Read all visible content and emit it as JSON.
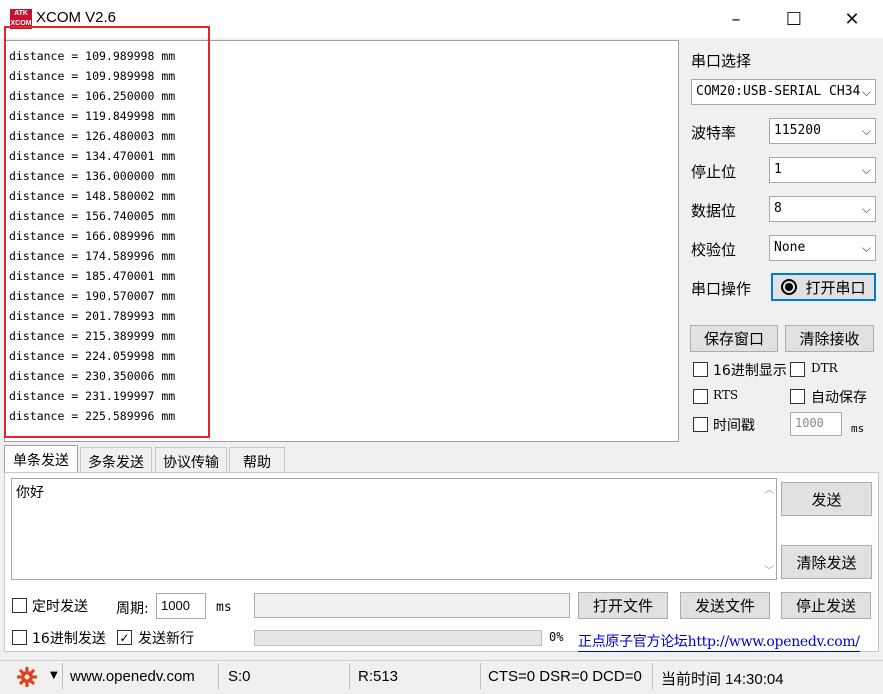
{
  "window": {
    "title": "XCOM V2.6",
    "logo_text": "ATK XCOM"
  },
  "titlebar": {
    "minimize": "–",
    "maximize": "☐",
    "close": "✕"
  },
  "receive": {
    "lines": [
      "distance = 109.989998 mm",
      "distance = 109.989998 mm",
      "distance = 106.250000 mm",
      "distance = 119.849998 mm",
      "distance = 126.480003 mm",
      "distance = 134.470001 mm",
      "distance = 136.000000 mm",
      "distance = 148.580002 mm",
      "distance = 156.740005 mm",
      "distance = 166.089996 mm",
      "distance = 174.589996 mm",
      "distance = 185.470001 mm",
      "distance = 190.570007 mm",
      "distance = 201.789993 mm",
      "distance = 215.389999 mm",
      "distance = 224.059998 mm",
      "distance = 230.350006 mm",
      "distance = 231.199997 mm",
      "distance = 225.589996 mm"
    ]
  },
  "settings": {
    "port_select_label": "串口选择",
    "port_value": "COM20:USB-SERIAL CH34",
    "baud_label": "波特率",
    "baud_value": "115200",
    "stopbits_label": "停止位",
    "stopbits_value": "1",
    "databits_label": "数据位",
    "databits_value": "8",
    "parity_label": "校验位",
    "parity_value": "None",
    "port_op_label": "串口操作",
    "open_port_button": "打开串口",
    "save_window_button": "保存窗口",
    "clear_receive_button": "清除接收",
    "hex_display_label": "16进制显示",
    "dtr_label": "DTR",
    "rts_label": "RTS",
    "auto_save_label": "自动保存",
    "timestamp_label": "时间戳",
    "timestamp_ms_value": "1000",
    "ms_unit": "ms"
  },
  "tabs": [
    "单条发送",
    "多条发送",
    "协议传输",
    "帮助"
  ],
  "send": {
    "text": "你好",
    "send_button": "发送",
    "clear_send_button": "清除发送",
    "timed_send_label": "定时发送",
    "period_label": "周期:",
    "period_value": "1000",
    "period_unit": "ms",
    "open_file_button": "打开文件",
    "send_file_button": "发送文件",
    "stop_send_button": "停止发送",
    "hex_send_label": "16进制发送",
    "send_newline_label": "发送新行",
    "send_newline_checked": true,
    "progress_text": "0%",
    "progress_value": 0,
    "forum_link": "正点原子官方论坛http://www.openedv.com/"
  },
  "status": {
    "url": "www.openedv.com",
    "sent": "S:0",
    "received": "R:513",
    "signals": "CTS=0 DSR=0 DCD=0",
    "time": "当前时间 14:30:04"
  },
  "colors": {
    "highlight_box": "#e0282a",
    "link": "#0000cc",
    "gear": "#e0401a"
  }
}
